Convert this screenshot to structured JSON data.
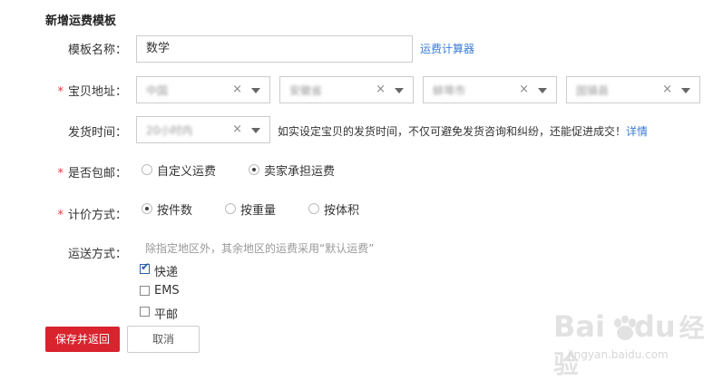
{
  "page": {
    "title": "新增运费模板"
  },
  "template_name": {
    "label": "模板名称：",
    "value": "数学",
    "link": "运费计算器"
  },
  "address": {
    "required_mark": "*",
    "label": "宝贝地址：",
    "selects": [
      {
        "value": "中国"
      },
      {
        "value": "安徽省"
      },
      {
        "value": "蚌埠市"
      },
      {
        "value": "固镇县"
      }
    ],
    "clear_glyph": "×"
  },
  "ship_time": {
    "label": "发货时间：",
    "value": "20小时内",
    "note": "如实设定宝贝的发货时间，不仅可避免发货咨询和纠纷，还能促进成交！",
    "link": "详情"
  },
  "free_shipping": {
    "required_mark": "*",
    "label": "是否包邮：",
    "options": [
      {
        "label": "自定义运费",
        "checked": false
      },
      {
        "label": "卖家承担运费",
        "checked": true
      }
    ]
  },
  "pricing": {
    "required_mark": "*",
    "label": "计价方式：",
    "options": [
      {
        "label": "按件数",
        "checked": true
      },
      {
        "label": "按重量",
        "checked": false
      },
      {
        "label": "按体积",
        "checked": false
      }
    ]
  },
  "delivery": {
    "label": "运送方式：",
    "hint": "除指定地区外，其余地区的运费采用“默认运费”",
    "options": [
      {
        "label": "快递",
        "checked": true
      },
      {
        "label": "EMS",
        "checked": false
      },
      {
        "label": "平邮",
        "checked": false
      }
    ]
  },
  "actions": {
    "save": "保存并返回",
    "cancel": "取消"
  },
  "watermark": {
    "brand": "Bai",
    "brand2": "du",
    "cn": "经验",
    "url": "jingyan.baidu.com"
  },
  "colors": {
    "primary": "#d9232d",
    "link": "#3a7bd5"
  }
}
